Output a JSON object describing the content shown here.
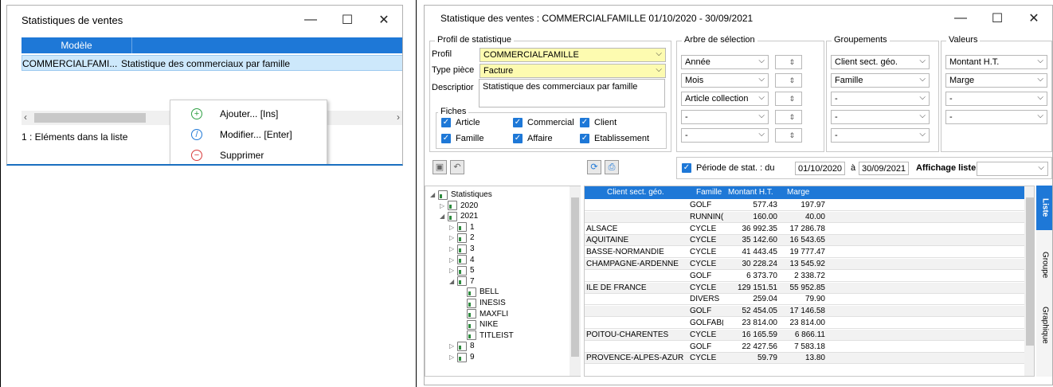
{
  "window1": {
    "title": "Statistiques de ventes",
    "controls": {
      "min": "—",
      "max": "☐",
      "close": "✕"
    },
    "column_header": "Modèle",
    "row": {
      "model": "COMMERCIALFAMI...",
      "description": "Statistique des commerciaux par famille"
    },
    "count": "1 : Eléments dans la liste",
    "context_menu": [
      {
        "label": "Ajouter... [Ins]",
        "icon": "plus-circle-icon"
      },
      {
        "label": "Modifier... [Enter]",
        "icon": "edit-circle-icon"
      },
      {
        "label": "Supprimer",
        "icon": "minus-circle-icon"
      }
    ]
  },
  "window2": {
    "title": "Statistique des ventes : COMMERCIALFAMILLE 01/10/2020 - 30/09/2021",
    "controls": {
      "min": "—",
      "max": "☐",
      "close": "✕"
    },
    "profil_group": {
      "title": "Profil de statistique",
      "profil_label": "Profil",
      "profil_value": "COMMERCIALFAMILLE",
      "type_label": "Type pièce",
      "type_value": "Facture",
      "desc_label": "Descriptior",
      "desc_value": "Statistique des commerciaux par famille"
    },
    "fiches": {
      "title": "Fiches",
      "items": [
        "Article",
        "Commercial",
        "Client",
        "Famille",
        "Affaire",
        "Etablissement"
      ]
    },
    "arbre": {
      "title": "Arbre de sélection",
      "items": [
        "Année",
        "Mois",
        "Article collection",
        "-",
        "-"
      ]
    },
    "groupements": {
      "title": "Groupements",
      "items": [
        "Client sect. géo.",
        "Famille",
        "-",
        "-",
        "-"
      ]
    },
    "valeurs": {
      "title": "Valeurs",
      "items": [
        "Montant H.T.",
        "Marge",
        "-",
        "-"
      ]
    },
    "periode": {
      "label": "Période de stat. : du",
      "from": "01/10/2020",
      "sep": "à",
      "to": "30/09/2021",
      "affichage_label": "Affichage liste"
    },
    "tree": [
      {
        "label": "Statistiques",
        "level": 0,
        "exp": "◢"
      },
      {
        "label": "2020",
        "level": 1,
        "exp": "▷"
      },
      {
        "label": "2021",
        "level": 1,
        "exp": "◢"
      },
      {
        "label": "1",
        "level": 2,
        "exp": "▷"
      },
      {
        "label": "2",
        "level": 2,
        "exp": "▷"
      },
      {
        "label": "3",
        "level": 2,
        "exp": "▷"
      },
      {
        "label": "4",
        "level": 2,
        "exp": "▷"
      },
      {
        "label": "5",
        "level": 2,
        "exp": "▷"
      },
      {
        "label": "7",
        "level": 2,
        "exp": "◢"
      },
      {
        "label": "BELL",
        "level": 3,
        "exp": ""
      },
      {
        "label": "INESIS",
        "level": 3,
        "exp": ""
      },
      {
        "label": "MAXFLI",
        "level": 3,
        "exp": ""
      },
      {
        "label": "NIKE",
        "level": 3,
        "exp": ""
      },
      {
        "label": "TITLEIST",
        "level": 3,
        "exp": ""
      },
      {
        "label": "8",
        "level": 2,
        "exp": "▷"
      },
      {
        "label": "9",
        "level": 2,
        "exp": "▷"
      }
    ],
    "table": {
      "headers": [
        "Client sect. géo.",
        "Famille",
        "Montant H.T.",
        "Marge"
      ],
      "rows": [
        [
          "",
          "GOLF",
          "577.43",
          "197.97"
        ],
        [
          "",
          "RUNNIN(",
          "160.00",
          "40.00"
        ],
        [
          "ALSACE",
          "CYCLE",
          "36 992.35",
          "17 286.78"
        ],
        [
          "AQUITAINE",
          "CYCLE",
          "35 142.60",
          "16 543.65"
        ],
        [
          "BASSE-NORMANDIE",
          "CYCLE",
          "41 443.45",
          "19 777.47"
        ],
        [
          "CHAMPAGNE-ARDENNE",
          "CYCLE",
          "30 228.24",
          "13 545.92"
        ],
        [
          "",
          "GOLF",
          "6 373.70",
          "2 338.72"
        ],
        [
          "ILE DE FRANCE",
          "CYCLE",
          "129 151.51",
          "55 952.85"
        ],
        [
          "",
          "DIVERS",
          "259.04",
          "79.90"
        ],
        [
          "",
          "GOLF",
          "52 454.05",
          "17 146.58"
        ],
        [
          "",
          "GOLFAB(",
          "23 814.00",
          "23 814.00"
        ],
        [
          "POITOU-CHARENTES",
          "CYCLE",
          "16 165.59",
          "6 866.11"
        ],
        [
          "",
          "GOLF",
          "22 427.56",
          "7 583.18"
        ],
        [
          "PROVENCE-ALPES-AZUR",
          "CYCLE",
          "59.79",
          "13.80"
        ]
      ]
    },
    "side_tabs": [
      "Liste",
      "Groupe",
      "Graphique"
    ],
    "accent": "#1e78d7"
  }
}
